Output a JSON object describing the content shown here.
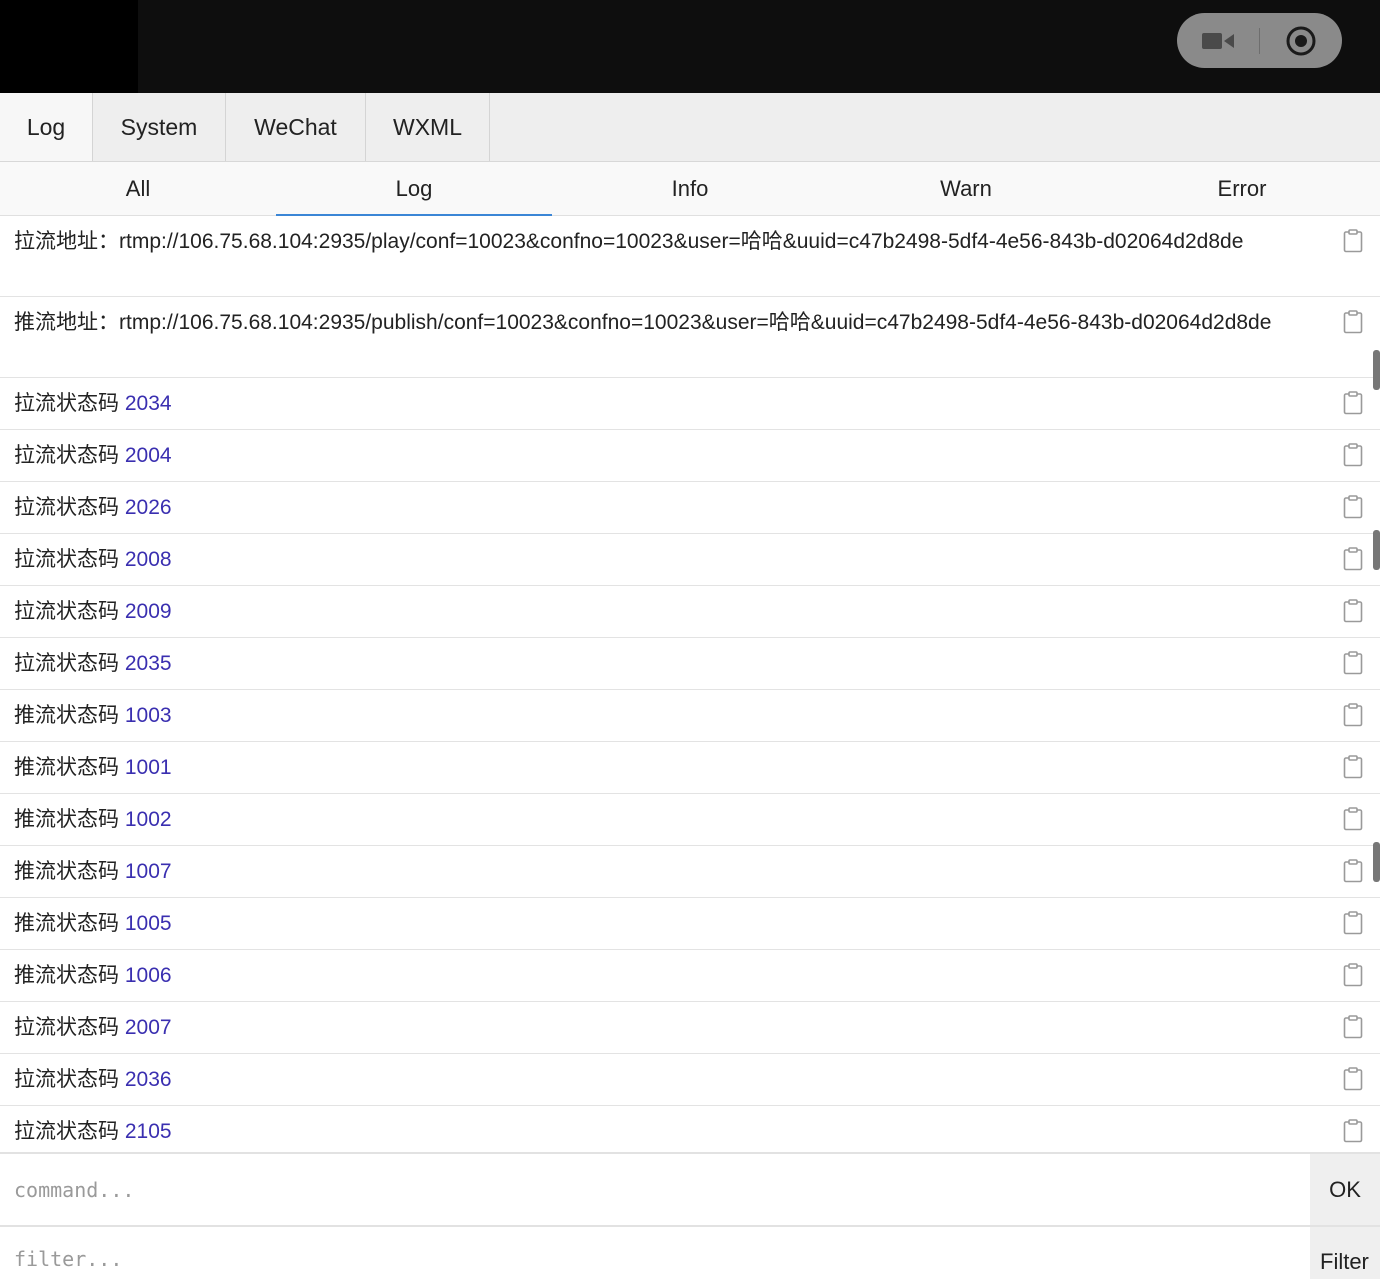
{
  "main_tabs": [
    {
      "label": "Log",
      "active": true
    },
    {
      "label": "System",
      "active": false
    },
    {
      "label": "WeChat",
      "active": false
    },
    {
      "label": "WXML",
      "active": false
    }
  ],
  "level_tabs": [
    {
      "label": "All",
      "active": false
    },
    {
      "label": "Log",
      "active": true
    },
    {
      "label": "Info",
      "active": false
    },
    {
      "label": "Warn",
      "active": false
    },
    {
      "label": "Error",
      "active": false
    }
  ],
  "log_entries": [
    {
      "label": "拉流地址：",
      "value": "rtmp://106.75.68.104:2935/play/conf=10023&confno=10023&user=哈哈&uuid=c47b2498-5df4-4e56-843b-d02064d2d8de",
      "kind": "url"
    },
    {
      "label": "推流地址：",
      "value": "rtmp://106.75.68.104:2935/publish/conf=10023&confno=10023&user=哈哈&uuid=c47b2498-5df4-4e56-843b-d02064d2d8de",
      "kind": "url"
    },
    {
      "label": "拉流状态码 ",
      "value": "2034",
      "kind": "code"
    },
    {
      "label": "拉流状态码 ",
      "value": "2004",
      "kind": "code"
    },
    {
      "label": "拉流状态码 ",
      "value": "2026",
      "kind": "code"
    },
    {
      "label": "拉流状态码 ",
      "value": "2008",
      "kind": "code"
    },
    {
      "label": "拉流状态码 ",
      "value": "2009",
      "kind": "code"
    },
    {
      "label": "拉流状态码 ",
      "value": "2035",
      "kind": "code"
    },
    {
      "label": "推流状态码 ",
      "value": "1003",
      "kind": "code"
    },
    {
      "label": "推流状态码 ",
      "value": "1001",
      "kind": "code"
    },
    {
      "label": "推流状态码 ",
      "value": "1002",
      "kind": "code"
    },
    {
      "label": "推流状态码 ",
      "value": "1007",
      "kind": "code"
    },
    {
      "label": "推流状态码 ",
      "value": "1005",
      "kind": "code"
    },
    {
      "label": "推流状态码 ",
      "value": "1006",
      "kind": "code"
    },
    {
      "label": "拉流状态码 ",
      "value": "2007",
      "kind": "code"
    },
    {
      "label": "拉流状态码 ",
      "value": "2036",
      "kind": "code"
    },
    {
      "label": "拉流状态码 ",
      "value": "2105",
      "kind": "code"
    }
  ],
  "command": {
    "placeholder": "command...",
    "button_label": "OK"
  },
  "filter": {
    "placeholder": "filter...",
    "button_label": "Filter"
  },
  "colors": {
    "code_value": "#3a2fb0",
    "active_tab_underline": "#3b86d6"
  },
  "icons": {
    "capsule_left": "video-camera-icon",
    "capsule_right": "record-target-icon",
    "row_action": "clipboard-icon"
  }
}
